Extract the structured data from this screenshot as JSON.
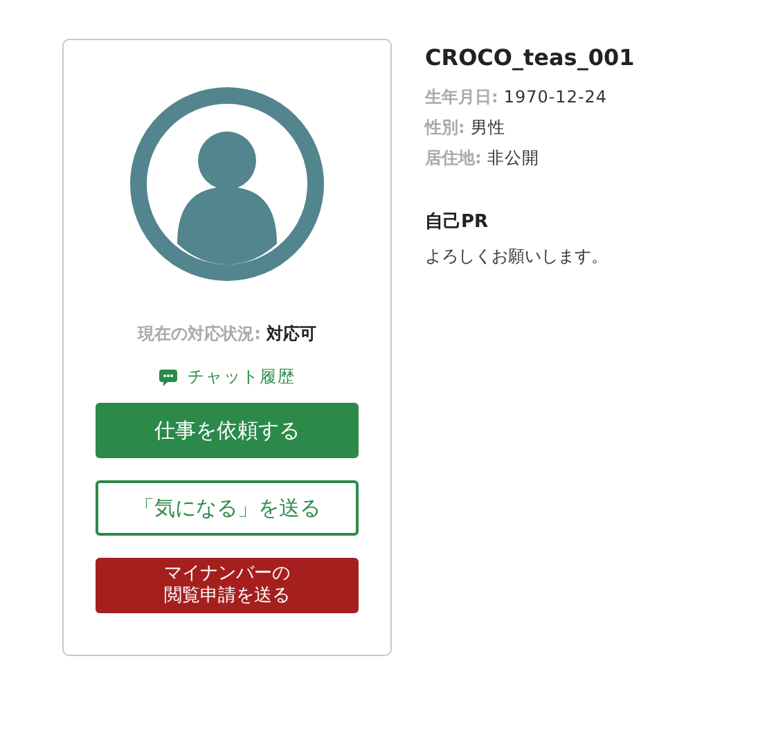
{
  "profile": {
    "status_label": "現在の対応状況:",
    "status_value": "対応可",
    "chat_link": "チャット履歴",
    "buttons": [
      {
        "kind": "primary",
        "label": "仕事を依頼する"
      },
      {
        "kind": "outline",
        "label": "「気になる」を送る"
      },
      {
        "kind": "danger",
        "label": "マイナンバーの閲覧申請を送る"
      }
    ]
  },
  "details": {
    "username": "CROCO_teas_001",
    "fields": [
      {
        "label": "生年月日:",
        "value": "1970-12-24"
      },
      {
        "label": "性別:",
        "value": "男性"
      },
      {
        "label": "居住地:",
        "value": "非公開"
      }
    ],
    "pr_heading": "自己PR",
    "pr_text": "よろしくお願いします。"
  }
}
